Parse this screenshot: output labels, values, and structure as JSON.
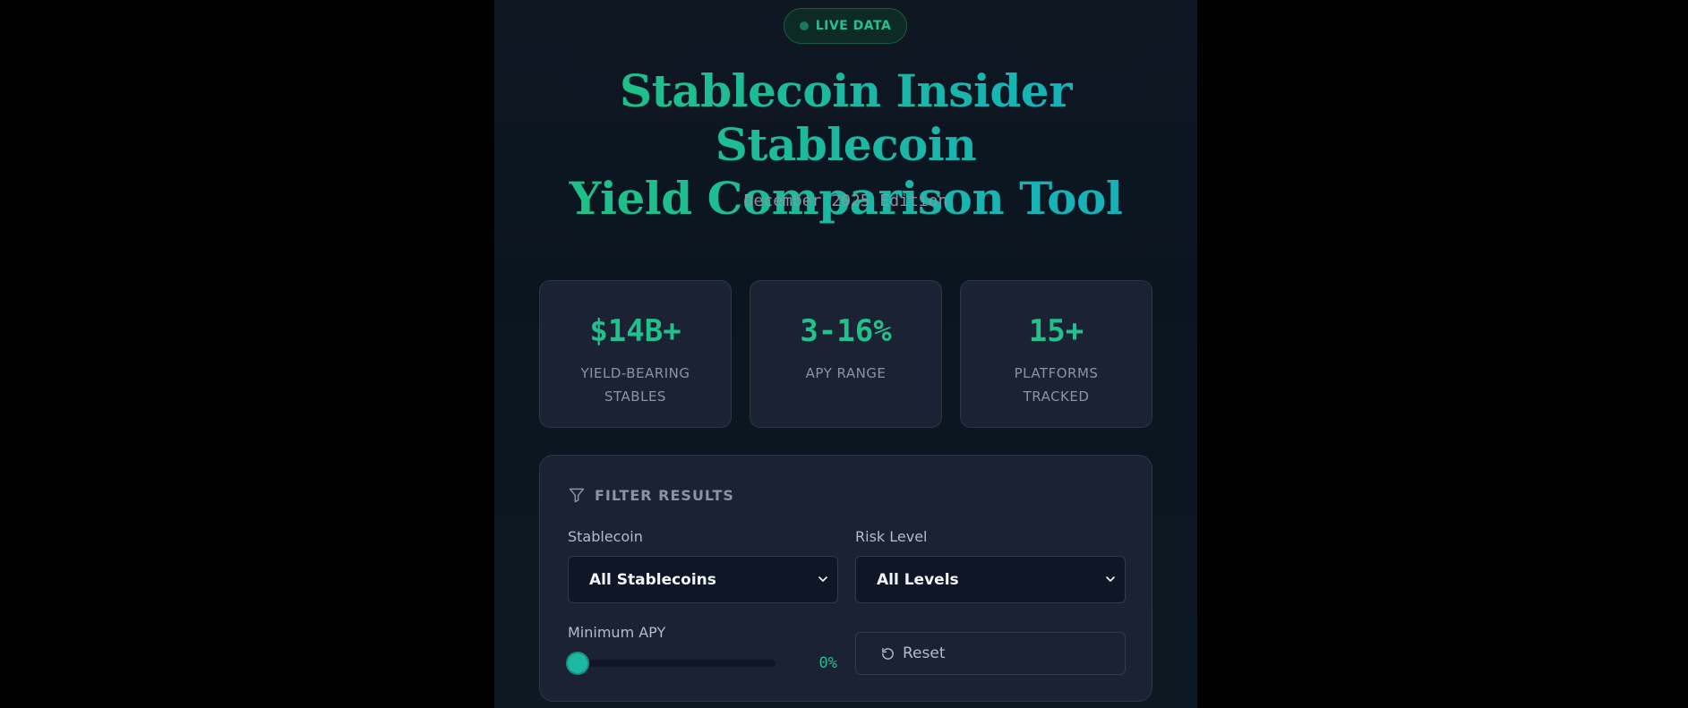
{
  "header": {
    "badge_label": "LIVE DATA",
    "title_line1": "Stablecoin Insider Stablecoin",
    "title_line2": "Yield Comparison Tool",
    "subtitle": "December 2025 Edition"
  },
  "stats": [
    {
      "value": "$14B+",
      "label": "YIELD-BEARING STABLES"
    },
    {
      "value": "3-16%",
      "label": "APY RANGE"
    },
    {
      "value": "15+",
      "label": "PLATFORMS TRACKED"
    }
  ],
  "filters": {
    "header": "FILTER RESULTS",
    "stablecoin_label": "Stablecoin",
    "stablecoin_value": "All Stablecoins",
    "risk_label": "Risk Level",
    "risk_value": "All Levels",
    "min_apy_label": "Minimum APY",
    "min_apy_value": "0%",
    "min_apy_fraction": 0,
    "reset_label": "Reset"
  },
  "colors": {
    "accent": "#22c08a",
    "teal": "#1bb8a4",
    "panel": "#1a2234",
    "background": "#0e1722"
  },
  "icons": {
    "badge": "live-dot-icon",
    "filter": "filter-icon",
    "select": "chevron-down-icon",
    "reset": "reset-icon"
  }
}
